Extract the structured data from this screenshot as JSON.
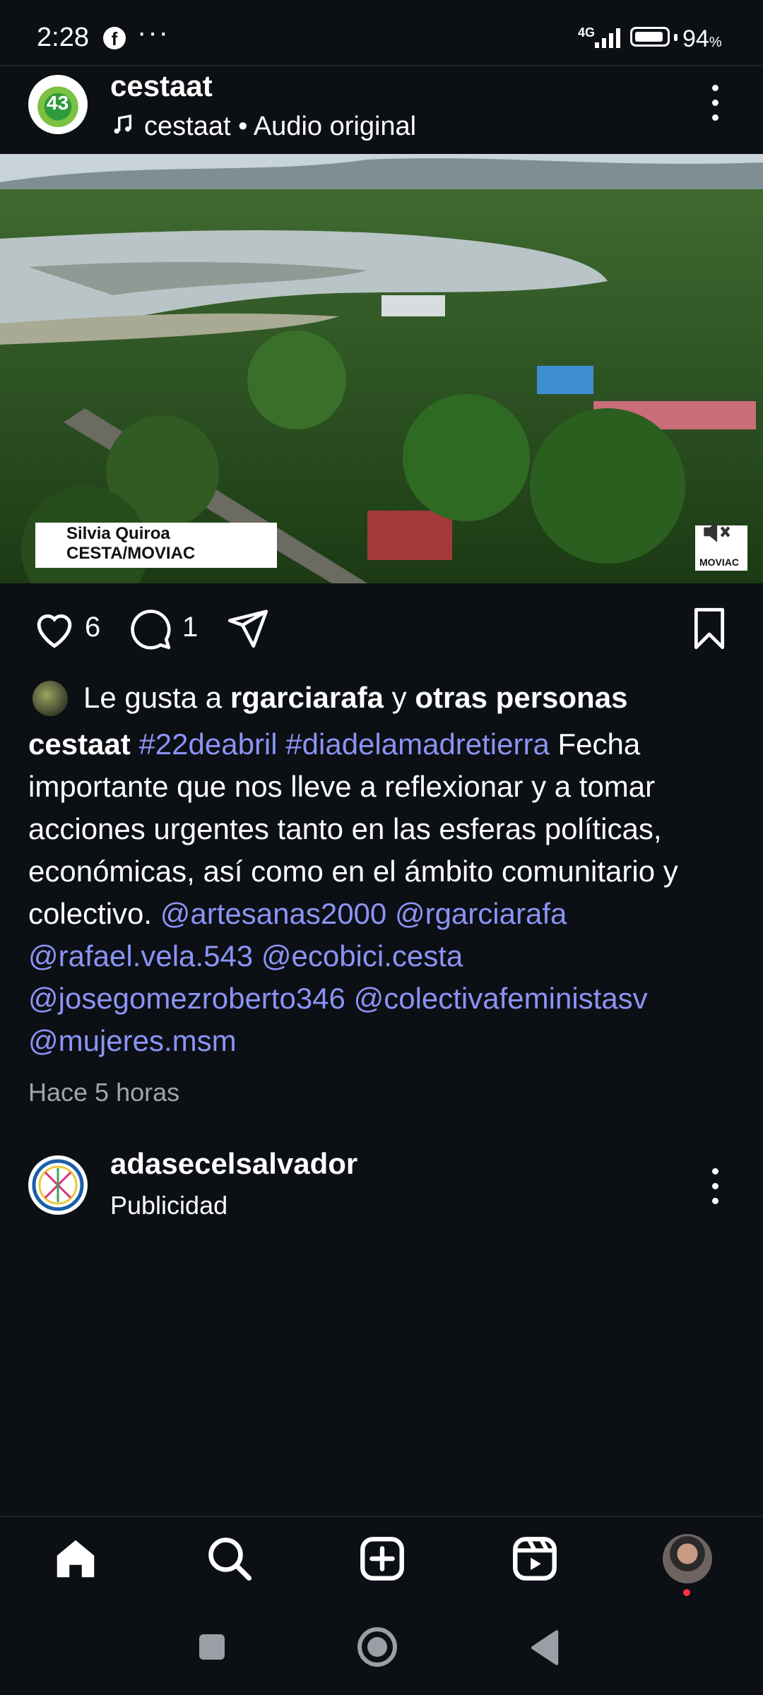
{
  "status_bar": {
    "time": "2:28",
    "network": "4G",
    "battery_percent": "94",
    "battery_level": 0.94,
    "icons": [
      "facebook-icon",
      "more-dots-icon",
      "signal-icon",
      "battery-icon"
    ]
  },
  "post": {
    "username": "cestaat",
    "avatar_text": "43",
    "audio": "cestaat • Audio original",
    "media": {
      "caption_name": "Silvia Quiroa",
      "caption_org": "CESTA/MOVIAC",
      "badge_text": "MOVIAC"
    },
    "likes_count": "6",
    "comments_count": "1",
    "liked_by": {
      "prefix": "Le gusta a ",
      "user": "rgarciarafa",
      "joiner": " y ",
      "others": "otras personas"
    },
    "caption": {
      "author": "cestaat",
      "hashtag1": "#22deabril",
      "hashtag2": "#diadelamadretierra",
      "text": "Fecha importante que nos lleve a reflexionar y a tomar acciones urgentes tanto en las esferas políticas, económicas, así como en el ámbito comunitario y colectivo.",
      "mentions": [
        "@artesanas2000",
        "@rgarciarafa",
        "@rafael.vela.543",
        "@ecobici.cesta",
        "@josegomezroberto346",
        "@colectivafeministasv",
        "@mujeres.msm"
      ]
    },
    "time_ago": "Hace 5 horas"
  },
  "ad_post": {
    "username": "adasecelsalvador",
    "subtitle": "Publicidad"
  },
  "colors": {
    "background": "#0c0f14",
    "link": "#8a94f5",
    "muted": "#a0a5ad",
    "notification_dot": "#ff3040"
  }
}
